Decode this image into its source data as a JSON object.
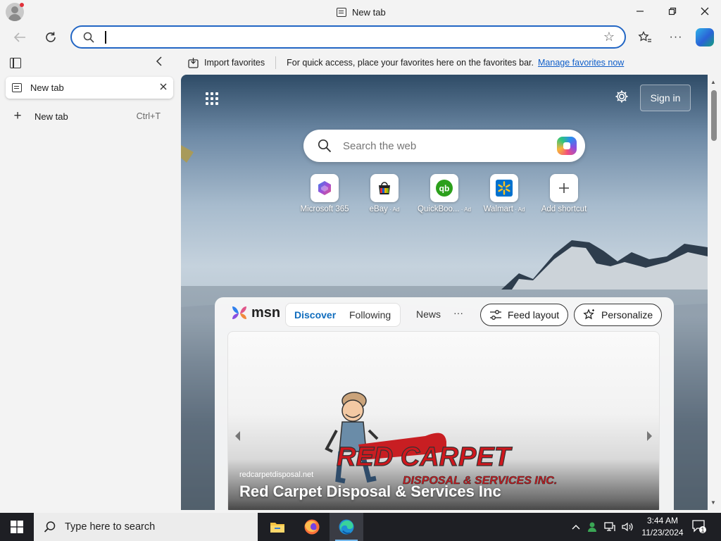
{
  "window": {
    "tab_title": "New tab",
    "minimize_icon": "minimize-icon",
    "maximize_icon": "restore-icon",
    "close_icon": "close-icon"
  },
  "toolbar": {
    "address_value": "",
    "address_placeholder": "",
    "accent": "#2266c4"
  },
  "favorites_bar": {
    "import_label": "Import favorites",
    "message": "For quick access, place your favorites here on the favorites bar.",
    "manage_link": "Manage favorites now"
  },
  "sidebar": {
    "open_tab_label": "New tab",
    "new_tab_label": "New tab",
    "new_tab_shortcut": "Ctrl+T"
  },
  "newtab_page": {
    "signin_label": "Sign in",
    "search_placeholder": "Search the web",
    "shortcuts": [
      {
        "label": "Microsoft 365",
        "ad": "",
        "icon": "microsoft365-icon"
      },
      {
        "label": "eBay",
        "ad": " · Ad",
        "icon": "ebay-icon"
      },
      {
        "label": "QuickBoo...",
        "ad": " · Ad",
        "icon": "quickbooks-icon"
      },
      {
        "label": "Walmart",
        "ad": " · Ad",
        "icon": "walmart-icon"
      },
      {
        "label": "Add shortcut",
        "ad": "",
        "icon": "plus-icon"
      }
    ]
  },
  "feed": {
    "brand": "msn",
    "tabs": [
      "Discover",
      "Following"
    ],
    "news_label": "News",
    "more_label": "···",
    "feed_layout_label": "Feed layout",
    "personalize_label": "Personalize",
    "card": {
      "source": "redcarpetdisposal.net",
      "title": "Red Carpet Disposal & Services Inc",
      "logo_text_1": "RED CARPET",
      "logo_text_2": "DISPOSAL & SERVICES INC."
    }
  },
  "taskbar": {
    "search_placeholder": "Type here to search",
    "time": "3:44 AM",
    "date": "11/23/2024",
    "notification_count": "1"
  }
}
